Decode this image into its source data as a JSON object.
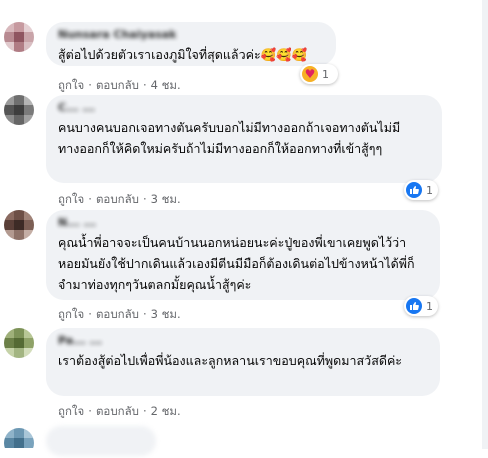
{
  "comments": [
    {
      "author": "Nunsara Chaiyasak",
      "text": "สู้ต่อไปด้วยตัวเราเองภูมิใจที่สุดแล้วค่ะ🥰🥰🥰",
      "actions": {
        "like": "ถูกใจ",
        "reply": "ตอบกลับ",
        "time": "4 ชม."
      },
      "reaction": {
        "icon": "care-reaction-icon",
        "count": "1"
      }
    },
    {
      "author": "C... ...",
      "text": "คนบางคนบอกเจอทางตันครับบอกไม่มีทางออกถ้าเจอทางตันไม่มีทางออกก็ให้คิดใหม่ครับถ้าไม่มีทางออกก็ให้ออกทางที่เข้าสู้ๆๆ",
      "actions": {
        "like": "ถูกใจ",
        "reply": "ตอบกลับ",
        "time": "3 ชม."
      },
      "reaction": {
        "icon": "like-reaction-icon",
        "count": "1"
      }
    },
    {
      "author": "N... ...",
      "text": "คุณน้ำพี่อาจจะเป็นคนบ้านนอกหน่อยนะค่ะปู่ของพี่เขาเคยพูดไว้ว่าหอยมันยังใช้ปากเดินแล้วเองมีตีนมีมือก็ต้องเดินต่อไปข้างหน้าได้พี่ก็จำมาท่องทุกๆวันตลกมั้ยคุณน้ำสู้ๆค่ะ",
      "actions": {
        "like": "ถูกใจ",
        "reply": "ตอบกลับ",
        "time": "3 ชม."
      },
      "reaction": {
        "icon": "like-reaction-icon",
        "count": "1"
      }
    },
    {
      "author": "Pa... ...",
      "text": "เราต้องสู้ต่อไปเพื่อพี่น้องและลูกหลานเราขอบคุณที่พูดมาสวัสดีค่ะ",
      "actions": {
        "like": "ถูกใจ",
        "reply": "ตอบกลับ",
        "time": "2 ชม."
      }
    }
  ],
  "colors": {
    "bubble": "#f0f2f5",
    "text": "#050505",
    "meta": "#65676b",
    "like": "#1877f2",
    "care": "#f7b125"
  }
}
